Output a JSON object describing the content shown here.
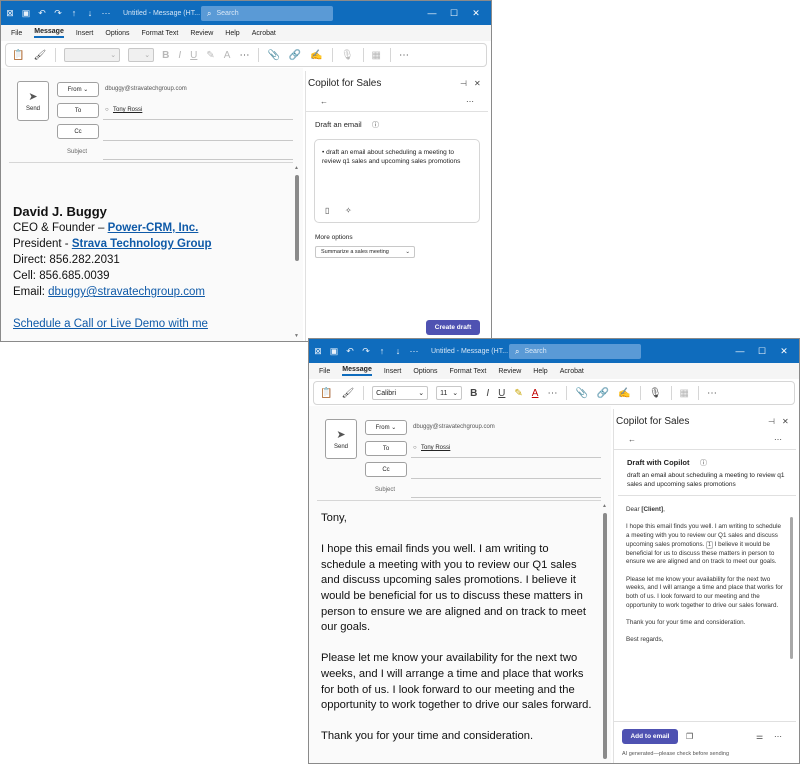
{
  "common": {
    "title": "Untitled  -  Message (HT...",
    "search_placeholder": "Search",
    "menu": [
      "File",
      "Message",
      "Insert",
      "Options",
      "Format Text",
      "Review",
      "Help",
      "Acrobat"
    ],
    "from_label": "From",
    "from_value": "dbuggy@stravatechgroup.com",
    "to_label": "To",
    "to_value": "Tony Rossi",
    "cc_label": "Cc",
    "subject_label": "Subject",
    "send_label": "Send",
    "copilot_title": "Copilot for Sales",
    "icons": [
      "send-icon",
      "undo-icon",
      "redo-icon",
      "bold-icon",
      "attach-icon",
      "pin-icon",
      "close-icon",
      "back-arrow-icon",
      "more-icon",
      "info-icon"
    ]
  },
  "window1": {
    "signature": {
      "name": "David J. Buggy",
      "line1_prefix": "CEO & Founder – ",
      "line1_link": "Power-CRM, Inc.",
      "line2_prefix": "President - ",
      "line2_link": "Strava Technology Group",
      "direct": "Direct: 856.282.2031",
      "cell": "Cell: 856.685.0039",
      "email_prefix": "Email: ",
      "email_link": "dbuggy@stravatechgroup.com",
      "schedule_link": "Schedule a Call or Live Demo with me"
    },
    "copilot": {
      "heading": "Draft an email",
      "prompt": "• draft an email about scheduling a meeting to review q1 sales and upcoming sales promotions",
      "more_options": "More options",
      "select_value": "Summarize a sales meeting",
      "create_button": "Create draft"
    }
  },
  "window2": {
    "font_name": "Calibri",
    "font_size": "11",
    "email_body": {
      "greeting": "Tony,",
      "p1": "I hope this email finds you well. I am writing to schedule a meeting with you to review our Q1 sales and discuss upcoming sales promotions. I believe it would be beneficial for us to discuss these matters in person to ensure we are aligned and on track to meet our goals.",
      "p2": "Please let me know your availability for the next two weeks, and I will arrange a time and place that works for both of us. I look forward to our meeting and the opportunity to work together to drive our sales forward.",
      "p3": "Thank you for your time and consideration."
    },
    "copilot": {
      "heading": "Draft with Copilot",
      "prompt_echo": "draft an email about scheduling a meeting to review q1 sales and upcoming sales promotions",
      "draft_greeting_prefix": "Dear ",
      "draft_greeting_client": "[Client]",
      "draft_greeting_suffix": ",",
      "draft_p1a": "I hope this email finds you well. I am writing to schedule a meeting with you to review our Q1 sales and discuss upcoming sales promotions.",
      "draft_ref": "1",
      "draft_p1b": "I believe it would be beneficial for us to discuss these matters in person to ensure we are aligned and on track to meet our goals.",
      "draft_p2": "Please let me know your availability for the next two weeks, and I will arrange a time and place that works for both of us. I look forward to our meeting and the opportunity to work together to drive our sales forward.",
      "draft_p3": "Thank you for your time and consideration.",
      "draft_p4": "Best regards,",
      "add_button": "Add to email",
      "ai_note": "AI generated—please check before sending"
    }
  }
}
